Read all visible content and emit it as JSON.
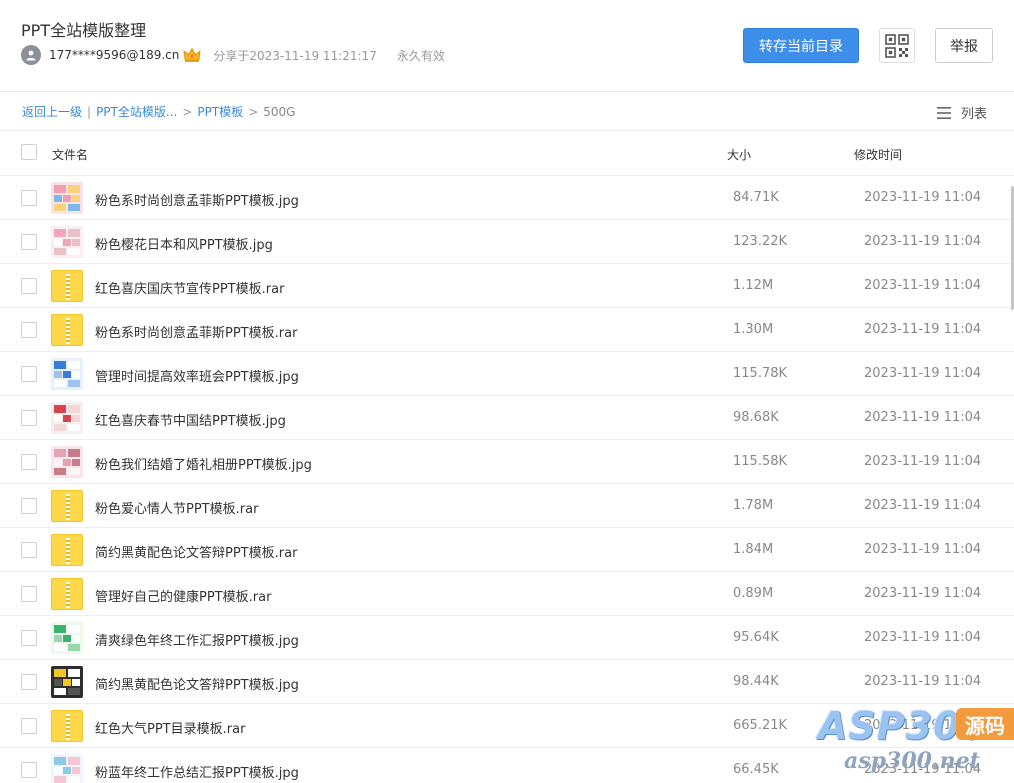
{
  "header": {
    "title": "PPT全站模版整理",
    "user": "177****9596@189.cn",
    "share_time": "分享于2023-11-19 11:21:17",
    "validity": "永久有效",
    "save_button": "转存当前目录",
    "report_button": "举报"
  },
  "breadcrumb": {
    "back": "返回上一级",
    "divider": "|",
    "items": [
      "PPT全站模版...",
      "PPT模板"
    ],
    "separator": ">",
    "current": "500G"
  },
  "view_toggle": {
    "label": "列表"
  },
  "columns": {
    "name": "文件名",
    "size": "大小",
    "time": "修改时间"
  },
  "files": [
    {
      "name": "粉色系时尚创意孟菲斯PPT模板.jpg",
      "size": "84.71K",
      "time": "2023-11-19 11:04",
      "type": "jpg"
    },
    {
      "name": "粉色樱花日本和风PPT模板.jpg",
      "size": "123.22K",
      "time": "2023-11-19 11:04",
      "type": "jpg"
    },
    {
      "name": "红色喜庆国庆节宣传PPT模板.rar",
      "size": "1.12M",
      "time": "2023-11-19 11:04",
      "type": "rar"
    },
    {
      "name": "粉色系时尚创意孟菲斯PPT模板.rar",
      "size": "1.30M",
      "time": "2023-11-19 11:04",
      "type": "rar"
    },
    {
      "name": "管理时间提高效率班会PPT模板.jpg",
      "size": "115.78K",
      "time": "2023-11-19 11:04",
      "type": "jpg"
    },
    {
      "name": "红色喜庆春节中国结PPT模板.jpg",
      "size": "98.68K",
      "time": "2023-11-19 11:04",
      "type": "jpg"
    },
    {
      "name": "粉色我们结婚了婚礼相册PPT模板.jpg",
      "size": "115.58K",
      "time": "2023-11-19 11:04",
      "type": "jpg"
    },
    {
      "name": "粉色爱心情人节PPT模板.rar",
      "size": "1.78M",
      "time": "2023-11-19 11:04",
      "type": "rar"
    },
    {
      "name": "简约黑黄配色论文答辩PPT模板.rar",
      "size": "1.84M",
      "time": "2023-11-19 11:04",
      "type": "rar"
    },
    {
      "name": "管理好自己的健康PPT模板.rar",
      "size": "0.89M",
      "time": "2023-11-19 11:04",
      "type": "rar"
    },
    {
      "name": "清爽绿色年终工作汇报PPT模板.jpg",
      "size": "95.64K",
      "time": "2023-11-19 11:04",
      "type": "jpg"
    },
    {
      "name": "简约黑黄配色论文答辩PPT模板.jpg",
      "size": "98.44K",
      "time": "2023-11-19 11:04",
      "type": "jpg"
    },
    {
      "name": "红色大气PPT目录模板.rar",
      "size": "665.21K",
      "time": "2023-11-19 11:04",
      "type": "rar"
    },
    {
      "name": "粉蓝年终工作总结汇报PPT模板.jpg",
      "size": "66.45K",
      "time": "2023-11-19 11:04",
      "type": "jpg"
    }
  ],
  "thumb_palettes": [
    [
      "#f6e4e8",
      "#f39fb3",
      "#f7d37a",
      "#7fb8e6"
    ],
    [
      "#fbeef0",
      "#f0a6b8",
      "#e9c1c9",
      "#ffffff"
    ],
    null,
    null,
    [
      "#e8f1fb",
      "#3a7bd5",
      "#ffffff",
      "#9ec4ee"
    ],
    [
      "#f7efef",
      "#d9434d",
      "#f2d7d7",
      "#ffffff"
    ],
    [
      "#f8e7ea",
      "#e3a3b2",
      "#c97a8b",
      "#fff4f6"
    ],
    null,
    null,
    null,
    [
      "#eef8ee",
      "#3bb26a",
      "#ffffff",
      "#9bd7ad"
    ],
    [
      "#2d2d2d",
      "#f3c623",
      "#ffffff",
      "#555555"
    ],
    null,
    [
      "#eef6fc",
      "#8ec9ea",
      "#f6c6d3",
      "#ffffff"
    ]
  ],
  "watermark": {
    "brand": "ASP300",
    "badge": "源码",
    "url": "asp300.net"
  }
}
